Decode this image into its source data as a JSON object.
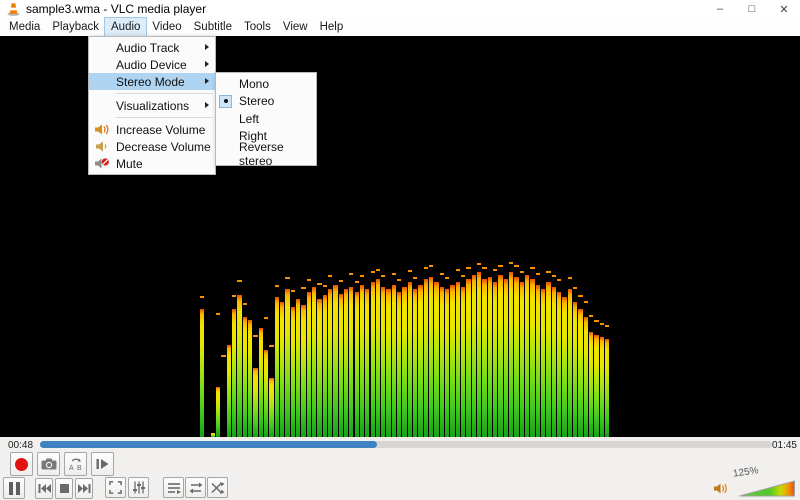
{
  "window": {
    "title": "sample3.wma - VLC media player",
    "minimize_glyph": "–",
    "maximize_glyph": "□",
    "close_glyph": "✕"
  },
  "menubar": {
    "items": [
      {
        "label": "Media"
      },
      {
        "label": "Playback"
      },
      {
        "label": "Audio",
        "active": true
      },
      {
        "label": "Video"
      },
      {
        "label": "Subtitle"
      },
      {
        "label": "Tools"
      },
      {
        "label": "View"
      },
      {
        "label": "Help"
      }
    ]
  },
  "audio_menu": {
    "audio_track": "Audio Track",
    "audio_device": "Audio Device",
    "stereo_mode": "Stereo Mode",
    "visualizations": "Visualizations",
    "increase_volume": "Increase Volume",
    "decrease_volume": "Decrease Volume",
    "mute": "Mute"
  },
  "stereo_submenu": {
    "mono": "Mono",
    "stereo": "Stereo",
    "left": "Left",
    "right": "Right",
    "reverse": "Reverse stereo",
    "selected": "Stereo"
  },
  "seekbar": {
    "elapsed": "00:48",
    "total": "01:45",
    "progress_pct": 46
  },
  "controls": {
    "row1": [
      "record",
      "snapshot",
      "ab-loop",
      "frame-by-frame"
    ],
    "row2": [
      "pause",
      "previous",
      "stop",
      "next",
      "fullscreen",
      "equalizer",
      "playlist",
      "loop",
      "random"
    ]
  },
  "volume": {
    "level": "125%"
  },
  "colors": {
    "accent_blue": "#3e82c4",
    "menu_highlight": "#aed4f2",
    "record_red": "#e01212",
    "bar_green": "#3ec81e",
    "bar_yellow": "#e6e600",
    "bar_tip_orange": "#f89000"
  },
  "visualization": {
    "bars": [
      [
        128,
        139
      ],
      [
        0,
        0
      ],
      [
        4,
        0
      ],
      [
        50,
        122
      ],
      [
        0,
        80
      ],
      [
        92,
        0
      ],
      [
        128,
        140
      ],
      [
        142,
        155
      ],
      [
        120,
        132
      ],
      [
        117,
        0
      ],
      [
        69,
        100
      ],
      [
        109,
        0
      ],
      [
        87,
        118
      ],
      [
        59,
        90
      ],
      [
        140,
        150
      ],
      [
        135,
        0
      ],
      [
        148,
        158
      ],
      [
        130,
        145
      ],
      [
        138,
        0
      ],
      [
        132,
        148
      ],
      [
        145,
        156
      ],
      [
        150,
        0
      ],
      [
        138,
        152
      ],
      [
        142,
        150
      ],
      [
        148,
        160
      ],
      [
        152,
        0
      ],
      [
        143,
        155
      ],
      [
        148,
        0
      ],
      [
        150,
        162
      ],
      [
        145,
        154
      ],
      [
        152,
        160
      ],
      [
        148,
        0
      ],
      [
        155,
        164
      ],
      [
        158,
        166
      ],
      [
        150,
        160
      ],
      [
        148,
        0
      ],
      [
        152,
        162
      ],
      [
        145,
        156
      ],
      [
        150,
        0
      ],
      [
        155,
        165
      ],
      [
        148,
        158
      ],
      [
        152,
        0
      ],
      [
        158,
        168
      ],
      [
        160,
        170
      ],
      [
        155,
        0
      ],
      [
        150,
        162
      ],
      [
        148,
        158
      ],
      [
        152,
        0
      ],
      [
        155,
        166
      ],
      [
        150,
        160
      ],
      [
        158,
        168
      ],
      [
        162,
        0
      ],
      [
        165,
        172
      ],
      [
        158,
        168
      ],
      [
        160,
        0
      ],
      [
        155,
        166
      ],
      [
        162,
        170
      ],
      [
        158,
        0
      ],
      [
        165,
        173
      ],
      [
        160,
        170
      ],
      [
        155,
        164
      ],
      [
        162,
        0
      ],
      [
        158,
        168
      ],
      [
        152,
        162
      ],
      [
        148,
        0
      ],
      [
        155,
        164
      ],
      [
        150,
        160
      ],
      [
        145,
        156
      ],
      [
        140,
        0
      ],
      [
        148,
        158
      ],
      [
        135,
        148
      ],
      [
        128,
        140
      ],
      [
        120,
        134
      ],
      [
        105,
        120
      ],
      [
        102,
        115
      ],
      [
        100,
        112
      ],
      [
        98,
        110
      ]
    ]
  }
}
